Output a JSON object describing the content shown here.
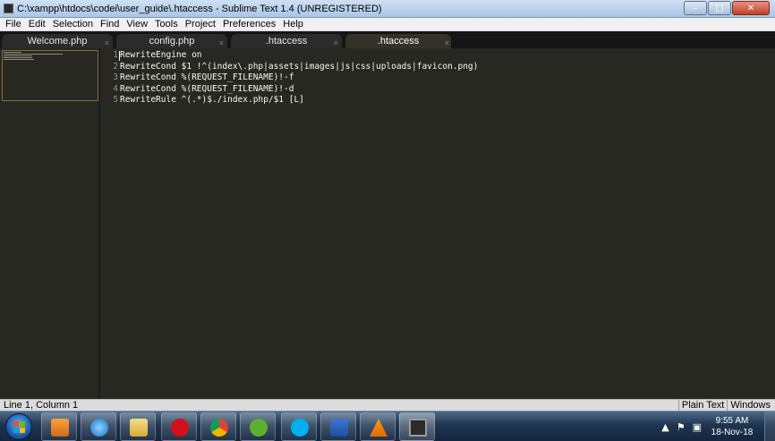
{
  "window": {
    "title": "C:\\xampp\\htdocs\\codei\\user_guide\\.htaccess - Sublime Text 1.4 (UNREGISTERED)",
    "minimize_label": "–",
    "maximize_label": "□",
    "close_label": "✕"
  },
  "menu": [
    "File",
    "Edit",
    "Selection",
    "Find",
    "View",
    "Tools",
    "Project",
    "Preferences",
    "Help"
  ],
  "tabs": [
    {
      "label": "Welcome.php",
      "close": "×"
    },
    {
      "label": "config.php",
      "close": "×"
    },
    {
      "label": ".htaccess",
      "close": "×"
    },
    {
      "label": ".htaccess",
      "close": "×"
    }
  ],
  "editor": {
    "line_numbers": [
      "1",
      "2",
      "3",
      "4",
      "5"
    ],
    "lines": [
      "RewriteEngine on",
      "RewriteCond $1 !^(index\\.php|assets|images|js|css|uploads|favicon.png)",
      "RewriteCond %(REQUEST_FILENAME)!-f",
      "RewriteCond %(REQUEST_FILENAME)!-d",
      "RewriteRule ^(.*)$./index.php/$1 [L]"
    ]
  },
  "status": {
    "position": "Line 1, Column 1",
    "syntax": "Plain Text",
    "line_endings": "Windows"
  },
  "taskbar": {
    "apps": [
      "media-player",
      "internet-explorer",
      "file-explorer",
      "opera",
      "chrome",
      "utorrent",
      "skype",
      "word",
      "vlc",
      "sublime-text"
    ],
    "tray_arrow": "▲",
    "time": "9:55 AM",
    "date": "18-Nov-18"
  }
}
